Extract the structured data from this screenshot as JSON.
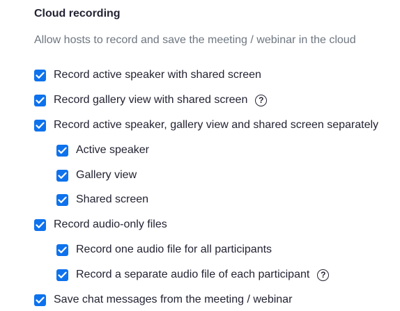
{
  "section": {
    "title": "Cloud recording",
    "description": "Allow hosts to record and save the meeting / webinar in the cloud"
  },
  "options": [
    {
      "label": "Record active speaker with shared screen",
      "checked": true
    },
    {
      "label": "Record gallery view with shared screen",
      "checked": true,
      "help_icon": "question-circle-icon"
    },
    {
      "label": "Record active speaker, gallery view and shared screen separately",
      "checked": true
    },
    {
      "label": "Active speaker",
      "checked": true
    },
    {
      "label": "Gallery view",
      "checked": true
    },
    {
      "label": "Shared screen",
      "checked": true
    },
    {
      "label": "Record audio-only files",
      "checked": true
    },
    {
      "label": "Record one audio file for all participants",
      "checked": true
    },
    {
      "label": "Record a separate audio file of each participant",
      "checked": true,
      "help_icon": "question-circle-icon"
    },
    {
      "label": "Save chat messages from the meeting / webinar",
      "checked": true
    }
  ],
  "help_glyph": "?",
  "colors": {
    "checkbox": "#0e72ed",
    "text": "#232333",
    "description": "#6e7680"
  }
}
